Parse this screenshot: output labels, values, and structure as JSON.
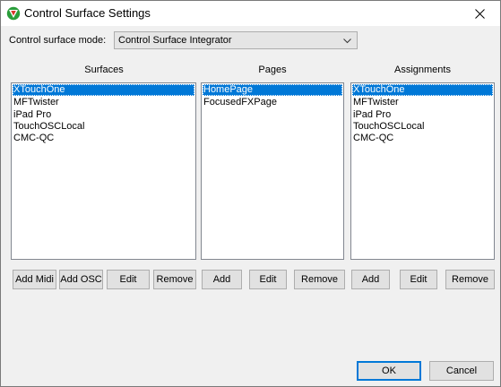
{
  "window": {
    "title": "Control Surface Settings",
    "icon": "reaper-icon",
    "close_icon": "close-icon"
  },
  "mode": {
    "label": "Control surface mode:",
    "value": "Control Surface Integrator"
  },
  "surfaces": {
    "header": "Surfaces",
    "items": [
      "XTouchOne",
      "MFTwister",
      "iPad Pro",
      "TouchOSCLocal",
      "CMC-QC"
    ],
    "selected_index": 0,
    "buttons": {
      "add_midi": "Add Midi",
      "add_osc": "Add OSC",
      "edit": "Edit",
      "remove": "Remove"
    }
  },
  "pages": {
    "header": "Pages",
    "items": [
      "HomePage",
      "FocusedFXPage"
    ],
    "selected_index": 0,
    "buttons": {
      "add": "Add",
      "edit": "Edit",
      "remove": "Remove"
    }
  },
  "assignments": {
    "header": "Assignments",
    "items": [
      "XTouchOne",
      "MFTwister",
      "iPad Pro",
      "TouchOSCLocal",
      "CMC-QC"
    ],
    "selected_index": 0,
    "buttons": {
      "add": "Add",
      "edit": "Edit",
      "remove": "Remove"
    }
  },
  "dialog": {
    "ok": "OK",
    "cancel": "Cancel"
  },
  "colors": {
    "selection": "#0078d7",
    "background": "#f0f0f0",
    "default_button_border": "#0078d7"
  }
}
